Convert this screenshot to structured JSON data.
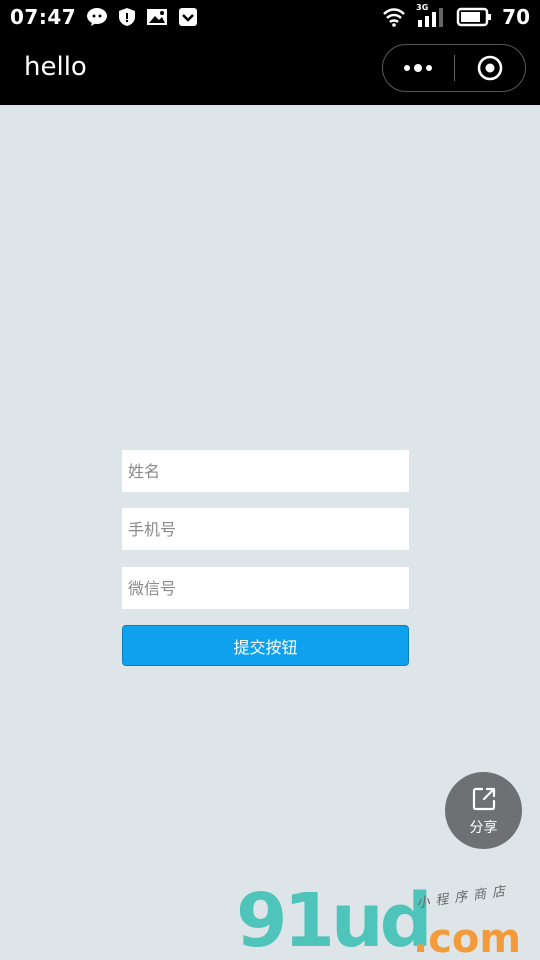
{
  "status_bar": {
    "time": "07:47",
    "battery_level": "70",
    "network_label": "3G",
    "left_icons": [
      "wechat-icon",
      "shield-icon",
      "image-icon",
      "pocket-icon"
    ],
    "right_icons": [
      "wifi-icon",
      "cellular-signal-icon",
      "battery-icon"
    ]
  },
  "nav_bar": {
    "title": "hello",
    "capsule": [
      "more-dots-icon",
      "target-close-icon"
    ]
  },
  "form": {
    "name_placeholder": "姓名",
    "phone_placeholder": "手机号",
    "wechat_placeholder": "微信号",
    "submit_label": "提交按钮"
  },
  "share": {
    "label": "分享",
    "icon": "share-external-icon"
  },
  "watermark": {
    "logo": "91ud",
    "suffix": ".com",
    "tagline": "小程序商店"
  },
  "colors": {
    "background": "#dde5e8",
    "bars": "#000000",
    "primary_button": "#0fa1ee",
    "share_fab": "#6e7173",
    "watermark_teal": "#4fc4bb",
    "watermark_orange": "#f39a3a"
  }
}
